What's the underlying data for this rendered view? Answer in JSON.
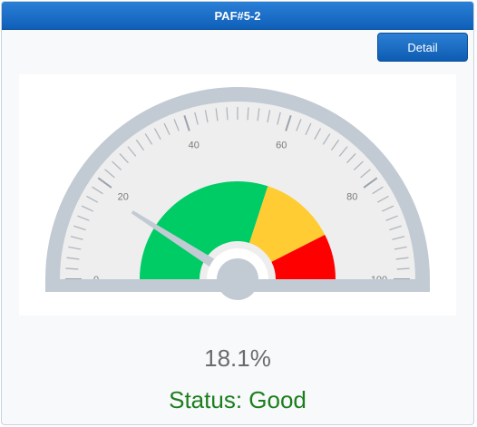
{
  "header": {
    "title": "PAF#5-2"
  },
  "toolbar": {
    "detail_label": "Detail"
  },
  "gauge": {
    "min": 0,
    "max": 100,
    "value": 18.1,
    "value_text": "18.1%",
    "status_text": "Status: Good",
    "tick_labels": [
      "0",
      "20",
      "40",
      "60",
      "80",
      "100"
    ],
    "bands": [
      {
        "name": "good",
        "from": 0,
        "to": 60,
        "color": "#00cc66"
      },
      {
        "name": "warning",
        "from": 60,
        "to": 85,
        "color": "#ffcc33"
      },
      {
        "name": "critical",
        "from": 85,
        "to": 100,
        "color": "#ff0000"
      }
    ],
    "colors": {
      "frame": "#c2cad3",
      "face": "#eeeeee",
      "needle": "#c2cad3",
      "status": "#1e7e1e",
      "value": "#6b6b6b"
    }
  }
}
